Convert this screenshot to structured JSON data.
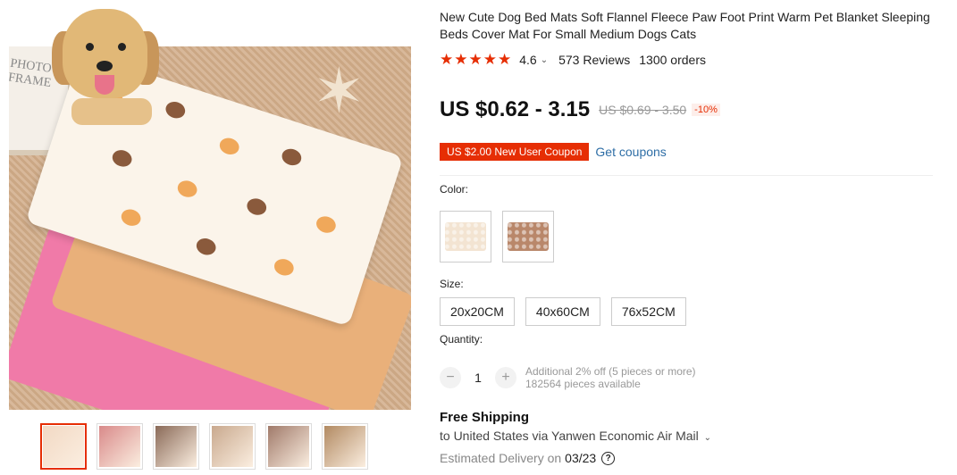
{
  "product": {
    "title": "New Cute Dog Bed Mats Soft Flannel Fleece Paw Foot Print Warm Pet Blanket Sleeping Beds Cover Mat For Small Medium Dogs Cats",
    "rating": "4.6",
    "rating_chevron": "⌄",
    "stars": [
      "★",
      "★",
      "★",
      "★",
      "★"
    ],
    "reviews": "573 Reviews",
    "orders": "1300 orders"
  },
  "price": {
    "current": "US $0.62 - 3.15",
    "original": "US $0.69 - 3.50",
    "discount": "-10%"
  },
  "coupon": {
    "label": "US $2.00 New User Coupon",
    "link": "Get coupons"
  },
  "color": {
    "label": "Color:",
    "options": [
      {
        "name": "cream-paw",
        "swatch": "#f3e4d2"
      },
      {
        "name": "brown-paw",
        "swatch": "#b9876a"
      }
    ]
  },
  "size": {
    "label": "Size:",
    "options": [
      "20x20CM",
      "40x60CM",
      "76x52CM"
    ]
  },
  "quantity": {
    "label": "Quantity:",
    "value": "1",
    "minus": "−",
    "plus": "+",
    "discount_note": "Additional 2% off (5 pieces or more)",
    "available": "182564 pieces available"
  },
  "shipping": {
    "title": "Free Shipping",
    "destination": "to United States via Yanwen Economic Air Mail",
    "destination_chevron": "⌄",
    "delivery_label": "Estimated Delivery on",
    "delivery_date": "03/23",
    "help_icon": "?"
  },
  "gallery": {
    "frame_text": "PHOTO FRAME",
    "thumbnails": [
      {
        "name": "thumb-1",
        "color": "#f2d9c4"
      },
      {
        "name": "thumb-2",
        "color": "#d98a8a"
      },
      {
        "name": "thumb-3",
        "color": "#8a6a58"
      },
      {
        "name": "thumb-4",
        "color": "#c9a98e"
      },
      {
        "name": "thumb-5",
        "color": "#a07a6a"
      },
      {
        "name": "thumb-6",
        "color": "#b28a62"
      }
    ]
  }
}
